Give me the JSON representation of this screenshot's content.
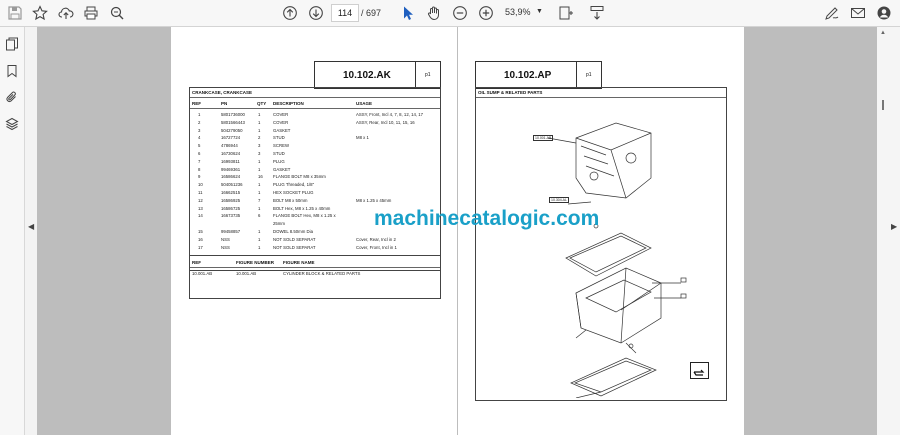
{
  "toolbar": {
    "page_current": "114",
    "page_total": "/ 697",
    "zoom": "53,9%"
  },
  "left_page": {
    "title": "10.102.AK",
    "page_tag": "p1",
    "section": "CRANKCASE, CRANKCASE",
    "headers": {
      "ref": "REF",
      "pn": "PN",
      "qty": "QTY",
      "description": "DESCRIPTION",
      "usage": "USAGE"
    },
    "rows": [
      {
        "ref": "1",
        "pn": "5801736000",
        "qty": "1",
        "desc": "COVER",
        "usage": "ASSY, Front, Incl 4, 7, 8, 12, 14, 17"
      },
      {
        "ref": "2",
        "pn": "5801566443",
        "qty": "1",
        "desc": "COVER",
        "usage": "ASSY, Rear, Incl 10, 11, 15, 16"
      },
      {
        "ref": "3",
        "pn": "504279050",
        "qty": "1",
        "desc": "GASKET",
        "usage": ""
      },
      {
        "ref": "4",
        "pn": "16727724",
        "qty": "2",
        "desc": "STUD",
        "usage": "M8 x 1"
      },
      {
        "ref": "5",
        "pn": "4786944",
        "qty": "3",
        "desc": "SCREW",
        "usage": ""
      },
      {
        "ref": "6",
        "pn": "16730624",
        "qty": "3",
        "desc": "STUD",
        "usage": ""
      },
      {
        "ref": "7",
        "pn": "16993811",
        "qty": "1",
        "desc": "PLUG",
        "usage": ""
      },
      {
        "ref": "8",
        "pn": "99469361",
        "qty": "1",
        "desc": "GASKET",
        "usage": ""
      },
      {
        "ref": "9",
        "pn": "16586624",
        "qty": "16",
        "desc": "FLANGE BOLT M8 x 35mm",
        "usage": ""
      },
      {
        "ref": "10",
        "pn": "504051236",
        "qty": "1",
        "desc": "PLUG Threaded, 1/8\"",
        "usage": ""
      },
      {
        "ref": "11",
        "pn": "16662515",
        "qty": "1",
        "desc": "HEX SOCKET PLUG",
        "usage": ""
      },
      {
        "ref": "12",
        "pn": "16586925",
        "qty": "7",
        "desc": "BOLT M8 x 50mm",
        "usage": "M8 x 1.25 x 45mm"
      },
      {
        "ref": "13",
        "pn": "16586725",
        "qty": "1",
        "desc": "BOLT Hex, M8 x 1.25 x 40mm",
        "usage": ""
      },
      {
        "ref": "14",
        "pn": "16673735",
        "qty": "6",
        "desc": "FLANGE BOLT Hex, M8 x 1.25 x",
        "usage": ""
      },
      {
        "ref": "",
        "pn": "",
        "qty": "",
        "desc": "25mm",
        "usage": ""
      },
      {
        "ref": "15",
        "pn": "99458857",
        "qty": "1",
        "desc": "DOWEL 8.50mm Dia",
        "usage": ""
      },
      {
        "ref": "16",
        "pn": "NSS",
        "qty": "1",
        "desc": "NOT SOLD SEPARAT",
        "usage": "Cover, Rear, Incl in 2"
      },
      {
        "ref": "17",
        "pn": "NSS",
        "qty": "1",
        "desc": "NOT SOLD SEPARAT",
        "usage": "Cover, Front, Incl in 1"
      }
    ],
    "fig_headers": {
      "ref": "REF",
      "figure_number": "FIGURE NUMBER",
      "figure_name": "FIGURE NAME"
    },
    "fig_rows": [
      {
        "ref": "10.001.AB",
        "figure_number": "10.001.AB",
        "figure_name": "CYLINDER BLOCK & RELATED PARTS"
      }
    ]
  },
  "right_page": {
    "title": "10.102.AP",
    "page_tag": "p1",
    "section": "OIL SUMP & RELATED PARTS",
    "callouts": [
      "10.001.AB",
      "10.304.AL"
    ]
  },
  "watermark": "machinecatalogic.com"
}
